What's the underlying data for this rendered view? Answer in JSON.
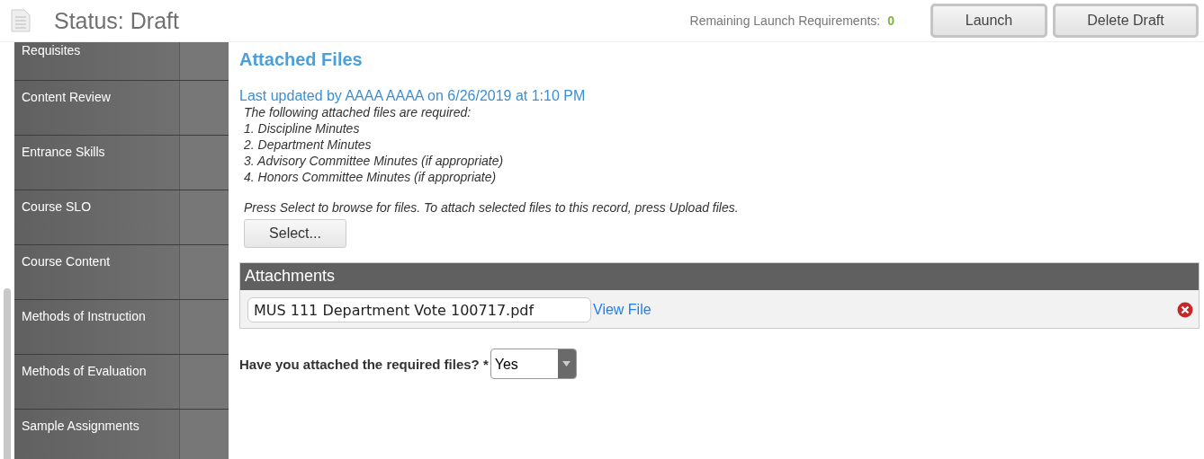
{
  "header": {
    "title": "Status: Draft",
    "requirements_label": "Remaining Launch Requirements:",
    "requirements_count": "0",
    "buttons": [
      "Launch",
      "Delete Draft"
    ]
  },
  "sidebar": {
    "items": [
      {
        "label": "Requisites",
        "selected": false
      },
      {
        "label": "Content Review",
        "selected": false
      },
      {
        "label": "Entrance Skills",
        "selected": false
      },
      {
        "label": "Course SLO",
        "selected": false
      },
      {
        "label": "Course Content",
        "selected": false
      },
      {
        "label": "Methods of Instruction",
        "selected": false
      },
      {
        "label": "Methods of Evaluation",
        "selected": false
      },
      {
        "label": "Sample Assignments",
        "selected": false
      }
    ]
  },
  "main": {
    "heading": "Attached Files",
    "last_updated": "Last updated by AAAA AAAA on 6/26/2019 at 1:10 PM",
    "instructions": [
      "The following attached files are required:",
      "1. Discipline Minutes",
      "2. Department Minutes",
      "3. Advisory Committee Minutes (if appropriate)",
      "4. Honors Committee Minutes (if appropriate)"
    ],
    "select_hint": "Press Select to browse for files. To attach selected files to this record, press Upload files.",
    "select_button": "Select...",
    "attachments": {
      "title": "Attachments",
      "files": [
        {
          "name": "MUS 111 Department Vote 100717.pdf",
          "link": "View File"
        }
      ]
    },
    "question": {
      "label": "Have you attached the required files? *",
      "value": "Yes"
    }
  }
}
